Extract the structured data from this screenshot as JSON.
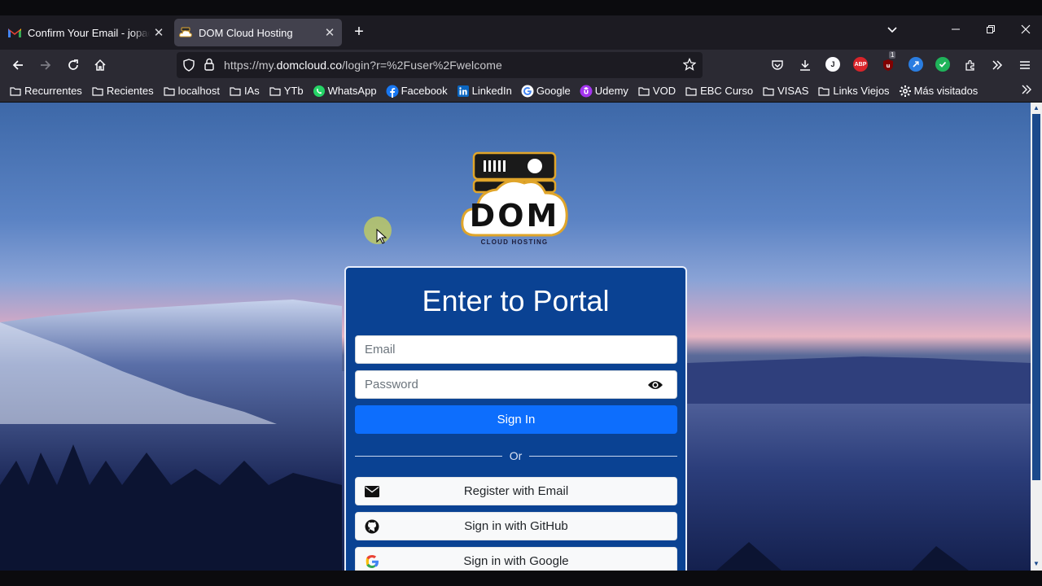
{
  "browser": {
    "tabs": [
      {
        "title": "Confirm Your Email - jopadu",
        "favicon": "gmail-icon",
        "active": false
      },
      {
        "title": "DOM Cloud Hosting",
        "favicon": "dom-cloud-icon",
        "active": true
      }
    ],
    "url": {
      "prefix": "https://my.",
      "host": "domcloud.co",
      "suffix": "/login?r=%2Fuser%2Fwelcome"
    },
    "extensions": [
      "pocket-icon",
      "download-icon",
      "j-extension-icon",
      "abp-icon",
      "ublock-icon",
      "link-extension-icon",
      "check-extension-icon",
      "extensions-icon",
      "overflow-icon",
      "menu-icon"
    ],
    "ublock_badge": "1",
    "abp_label": "ABP",
    "j_label": "J"
  },
  "bookmarks": [
    {
      "label": "Recurrentes",
      "icon": "folder-icon"
    },
    {
      "label": "Recientes",
      "icon": "folder-icon"
    },
    {
      "label": "localhost",
      "icon": "folder-icon"
    },
    {
      "label": "IAs",
      "icon": "folder-icon"
    },
    {
      "label": "YTb",
      "icon": "folder-icon"
    },
    {
      "label": "WhatsApp",
      "icon": "whatsapp-icon"
    },
    {
      "label": "Facebook",
      "icon": "facebook-icon"
    },
    {
      "label": "LinkedIn",
      "icon": "linkedin-icon"
    },
    {
      "label": "Google",
      "icon": "google-icon"
    },
    {
      "label": "Udemy",
      "icon": "udemy-icon"
    },
    {
      "label": "VOD",
      "icon": "folder-icon"
    },
    {
      "label": "EBC Curso",
      "icon": "folder-icon"
    },
    {
      "label": "VISAS",
      "icon": "folder-icon"
    },
    {
      "label": "Links Viejos",
      "icon": "folder-icon"
    },
    {
      "label": "Más visitados",
      "icon": "gear-icon"
    }
  ],
  "logo": {
    "text": "DOM",
    "subtitle": "CLOUD HOSTING"
  },
  "login": {
    "title": "Enter to Portal",
    "email_placeholder": "Email",
    "password_placeholder": "Password",
    "signin_label": "Sign In",
    "divider_text": "Or",
    "register_label": "Register with Email",
    "github_label": "Sign in with GitHub",
    "google_label": "Sign in with Google"
  },
  "colors": {
    "card_bg": "#0a4293",
    "primary_button": "#0d6efd",
    "browser_chrome": "#2b2a33"
  }
}
